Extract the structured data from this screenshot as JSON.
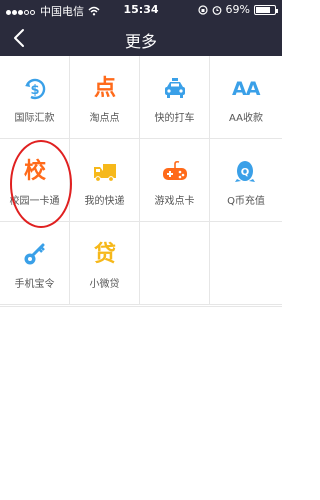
{
  "status": {
    "carrier": "中国电信",
    "time": "15:34",
    "battery": "69%",
    "battery_level": 0.69
  },
  "nav": {
    "title": "更多"
  },
  "items": [
    {
      "label": "国际汇款",
      "icon": "dollar-globe-icon",
      "glyph": "",
      "color": "#3aa0e8"
    },
    {
      "label": "淘点点",
      "icon": "taodiandian-icon",
      "glyph": "点",
      "color": "#ff6a1a"
    },
    {
      "label": "快的打车",
      "icon": "taxi-icon",
      "glyph": "",
      "color": "#3aa0e8"
    },
    {
      "label": "AA收款",
      "icon": "aa-icon",
      "glyph": "AA",
      "color": "#3aa0e8"
    },
    {
      "label": "校园一卡通",
      "icon": "campus-card-icon",
      "glyph": "校",
      "color": "#ff6a1a"
    },
    {
      "label": "我的快递",
      "icon": "delivery-truck-icon",
      "glyph": "",
      "color": "#f6b81a"
    },
    {
      "label": "游戏点卡",
      "icon": "gamepad-icon",
      "glyph": "",
      "color": "#ff6a1a"
    },
    {
      "label": "Q币充值",
      "icon": "qq-penguin-icon",
      "glyph": "Q",
      "color": "#3aa0e8"
    },
    {
      "label": "手机宝令",
      "icon": "key-icon",
      "glyph": "",
      "color": "#3aa0e8"
    },
    {
      "label": "小微贷",
      "icon": "loan-icon",
      "glyph": "贷",
      "color": "#f6b81a"
    }
  ]
}
